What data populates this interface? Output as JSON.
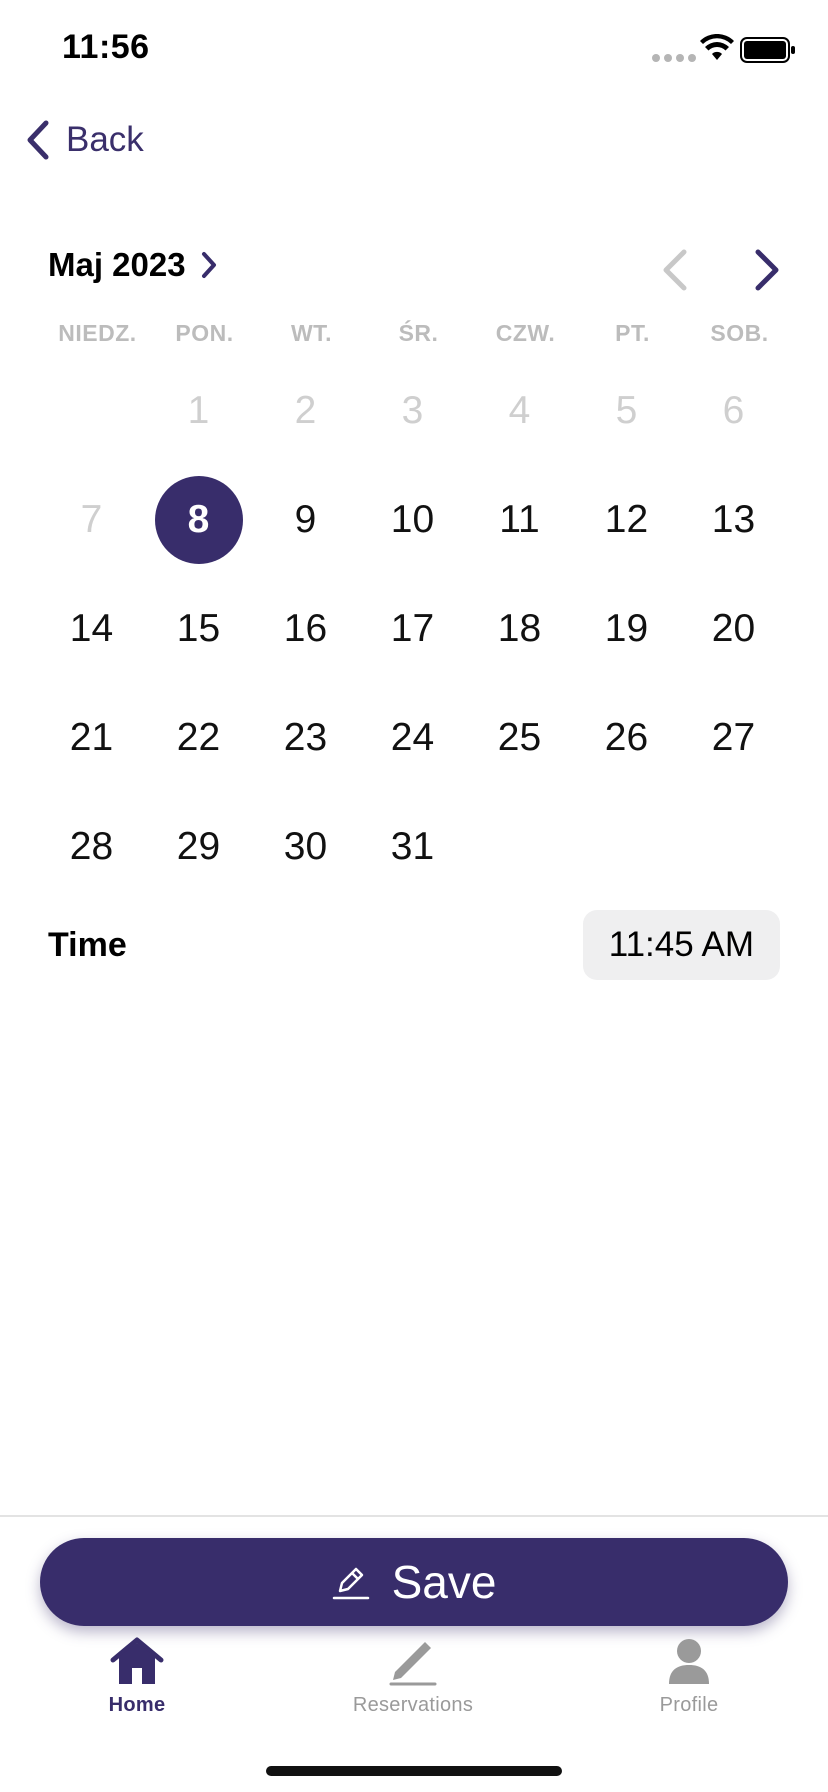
{
  "status_bar": {
    "time": "11:56"
  },
  "nav": {
    "back_label": "Back"
  },
  "calendar": {
    "month_label": "Maj 2023",
    "weekdays": [
      "NIEDZ.",
      "PON.",
      "WT.",
      "ŚR.",
      "CZW.",
      "PT.",
      "SOB."
    ],
    "selected_day": "8",
    "weeks": [
      [
        "",
        "1",
        "2",
        "3",
        "4",
        "5",
        "6"
      ],
      [
        "7",
        "8",
        "9",
        "10",
        "11",
        "12",
        "13"
      ],
      [
        "14",
        "15",
        "16",
        "17",
        "18",
        "19",
        "20"
      ],
      [
        "21",
        "22",
        "23",
        "24",
        "25",
        "26",
        "27"
      ],
      [
        "28",
        "29",
        "30",
        "31",
        "",
        "",
        ""
      ]
    ],
    "disabled_days": [
      "1",
      "2",
      "3",
      "4",
      "5",
      "6",
      "7"
    ]
  },
  "time": {
    "label": "Time",
    "value": "11:45 AM"
  },
  "save": {
    "label": "Save"
  },
  "tabbar": {
    "items": [
      {
        "label": "Home",
        "icon": "house-icon",
        "active": true
      },
      {
        "label": "Reservations",
        "icon": "pencil-icon",
        "active": false
      },
      {
        "label": "Profile",
        "icon": "person-icon",
        "active": false
      }
    ]
  },
  "colors": {
    "accent": "#382d6b",
    "muted": "#cfcfcf",
    "tab_inactive": "#9a9a9a"
  }
}
